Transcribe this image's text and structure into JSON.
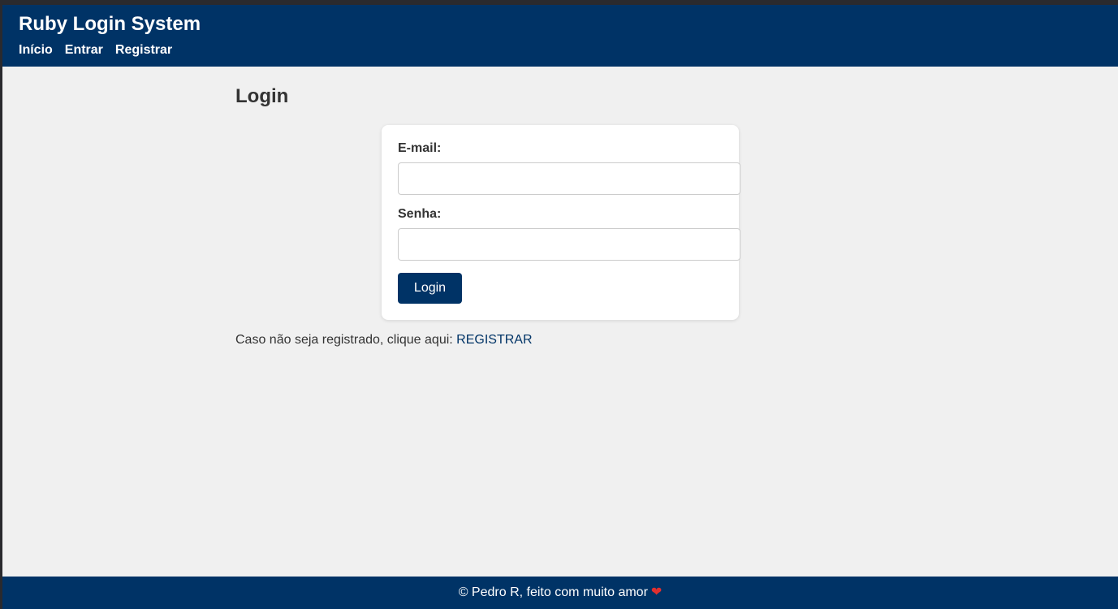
{
  "header": {
    "title": "Ruby Login System",
    "nav": [
      {
        "label": "Início"
      },
      {
        "label": "Entrar"
      },
      {
        "label": "Registrar"
      }
    ]
  },
  "main": {
    "title": "Login",
    "form": {
      "email_label": "E-mail:",
      "email_value": "",
      "password_label": "Senha:",
      "password_value": "",
      "submit_label": "Login"
    },
    "register_prompt": "Caso não seja registrado, clique aqui: ",
    "register_link": "REGISTRAR"
  },
  "footer": {
    "text": "© Pedro R, feito com muito amor",
    "heart_glyph": "❤",
    "heart_icon": "heart-icon"
  },
  "colors": {
    "primary": "#003366",
    "background": "#f0f0f0",
    "card": "#ffffff",
    "text": "#333333",
    "heart": "#e0302f"
  }
}
